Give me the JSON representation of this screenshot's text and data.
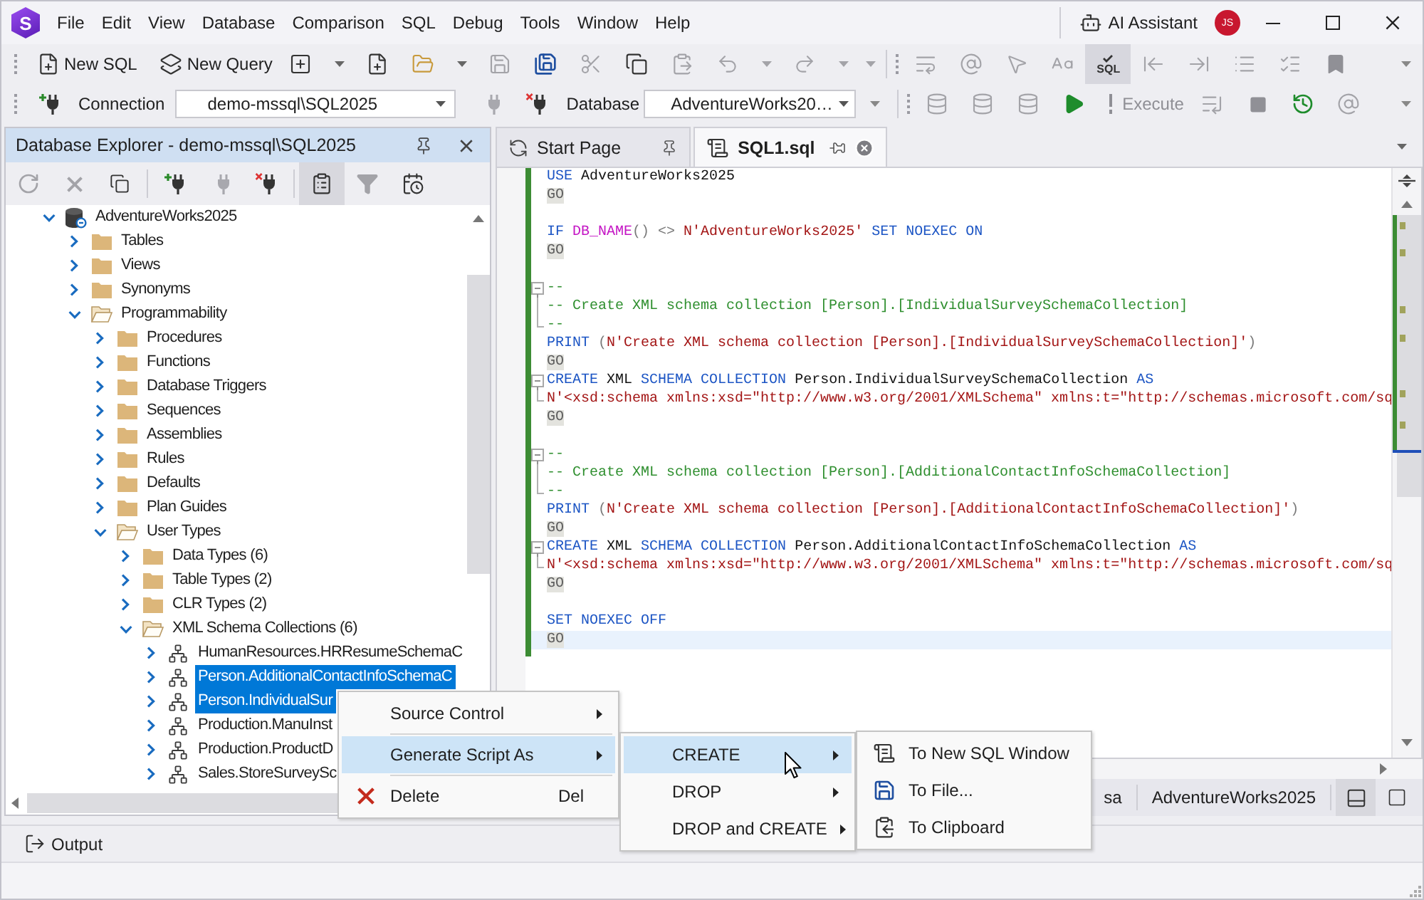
{
  "menu_bar": {
    "logo_letter": "S",
    "items": [
      "File",
      "Edit",
      "View",
      "Database",
      "Comparison",
      "SQL",
      "Debug",
      "Tools",
      "Window",
      "Help"
    ],
    "ai_assistant": "AI Assistant",
    "avatar_initials": "JS"
  },
  "main_toolbar": {
    "buttons": [
      "New SQL",
      "New Query"
    ],
    "sql_check": {
      "label": "SQL",
      "pressed": true
    }
  },
  "connection_toolbar": {
    "connection_label": "Connection",
    "connection": "demo-mssql\\SQL2025",
    "database_label": "Database",
    "database": "AdventureWorks20…",
    "execute": {
      "label": "Execute",
      "disabled": true
    }
  },
  "database_explorer": {
    "title": "Database Explorer - demo-mssql\\SQL2025",
    "tree": [
      {
        "label": "AdventureWorks2025",
        "kind": "database",
        "expanded": true,
        "selected": false,
        "children": [
          {
            "label": "Tables",
            "kind": "folder",
            "expanded": false,
            "selected": false
          },
          {
            "label": "Views",
            "kind": "folder",
            "expanded": false,
            "selected": false
          },
          {
            "label": "Synonyms",
            "kind": "folder",
            "expanded": false,
            "selected": false
          },
          {
            "label": "Programmability",
            "kind": "folder",
            "expanded": true,
            "selected": false,
            "children": [
              {
                "label": "Procedures",
                "kind": "folder",
                "expanded": false,
                "selected": false
              },
              {
                "label": "Functions",
                "kind": "folder",
                "expanded": false,
                "selected": false
              },
              {
                "label": "Database Triggers",
                "kind": "folder",
                "expanded": false,
                "selected": false
              },
              {
                "label": "Sequences",
                "kind": "folder",
                "expanded": false,
                "selected": false
              },
              {
                "label": "Assemblies",
                "kind": "folder",
                "expanded": false,
                "selected": false
              },
              {
                "label": "Rules",
                "kind": "folder",
                "expanded": false,
                "selected": false
              },
              {
                "label": "Defaults",
                "kind": "folder",
                "expanded": false,
                "selected": false
              },
              {
                "label": "Plan Guides",
                "kind": "folder",
                "expanded": false,
                "selected": false
              },
              {
                "label": "User Types",
                "kind": "folder",
                "expanded": true,
                "selected": false,
                "children": [
                  {
                    "label": "Data Types (6)",
                    "kind": "folder",
                    "expanded": false,
                    "selected": false
                  },
                  {
                    "label": "Table Types (2)",
                    "kind": "folder",
                    "expanded": false,
                    "selected": false
                  },
                  {
                    "label": "CLR Types (2)",
                    "kind": "folder",
                    "expanded": false,
                    "selected": false
                  },
                  {
                    "label": "XML Schema Collections (6)",
                    "kind": "folder",
                    "expanded": true,
                    "selected": false,
                    "children": [
                      {
                        "label": "HumanResources.HRResumeSchemaC",
                        "kind": "xml-schema",
                        "expanded": false,
                        "selected": false
                      },
                      {
                        "label": "Person.AdditionalContactInfoSchemaC",
                        "kind": "xml-schema",
                        "expanded": false,
                        "selected": true
                      },
                      {
                        "label": "Person.IndividualSur",
                        "kind": "xml-schema",
                        "expanded": false,
                        "selected": true
                      },
                      {
                        "label": "Production.ManuInst",
                        "kind": "xml-schema",
                        "expanded": false,
                        "selected": false
                      },
                      {
                        "label": "Production.ProductD",
                        "kind": "xml-schema",
                        "expanded": false,
                        "selected": false
                      },
                      {
                        "label": "Sales.StoreSurveySc",
                        "kind": "xml-schema",
                        "expanded": false,
                        "selected": false
                      }
                    ]
                  }
                ]
              }
            ]
          }
        ]
      }
    ]
  },
  "editor_tabs": [
    {
      "label": "Start Page",
      "selected": false,
      "pinned": true
    },
    {
      "label": "SQL1.sql",
      "selected": true,
      "pinned": false
    }
  ],
  "editor": {
    "lines": [
      {
        "kind": "code",
        "tokens": [
          {
            "kind": "keyword",
            "text": "USE"
          },
          {
            "kind": "plain",
            "text": " AdventureWorks2025"
          }
        ]
      },
      {
        "kind": "code",
        "tokens": [
          {
            "kind": "batch",
            "text": "GO"
          }
        ]
      },
      {
        "kind": "blank"
      },
      {
        "kind": "code",
        "tokens": [
          {
            "kind": "keyword",
            "text": "IF"
          },
          {
            "kind": "function",
            "text": " DB_NAME"
          },
          {
            "kind": "operator",
            "text": "() <> "
          },
          {
            "kind": "string",
            "text": "N'AdventureWorks2025'"
          },
          {
            "kind": "keyword",
            "text": " SET NOEXEC ON"
          }
        ]
      },
      {
        "kind": "code",
        "tokens": [
          {
            "kind": "batch",
            "text": "GO"
          }
        ]
      },
      {
        "kind": "blank"
      },
      {
        "kind": "code",
        "fold_start": true,
        "tokens": [
          {
            "kind": "comment",
            "text": "--"
          }
        ]
      },
      {
        "kind": "code",
        "fold_middle": true,
        "tokens": [
          {
            "kind": "comment",
            "text": "-- Create XML schema collection [Person].[IndividualSurveySchemaCollection]"
          }
        ]
      },
      {
        "kind": "code",
        "fold_end": true,
        "tokens": [
          {
            "kind": "comment",
            "text": "--"
          }
        ]
      },
      {
        "kind": "code",
        "tokens": [
          {
            "kind": "keyword",
            "text": "PRINT"
          },
          {
            "kind": "operator",
            "text": " ("
          },
          {
            "kind": "string",
            "text": "N'Create XML schema collection [Person].[IndividualSurveySchemaCollection]'"
          },
          {
            "kind": "operator",
            "text": ")"
          }
        ]
      },
      {
        "kind": "code",
        "tokens": [
          {
            "kind": "batch",
            "text": "GO"
          }
        ]
      },
      {
        "kind": "code",
        "fold_start": true,
        "tokens": [
          {
            "kind": "keyword",
            "text": "CREATE"
          },
          {
            "kind": "plain",
            "text": " XML "
          },
          {
            "kind": "keyword",
            "text": "SCHEMA COLLECTION"
          },
          {
            "kind": "plain",
            "text": " Person.IndividualSurveySchemaCollection "
          },
          {
            "kind": "keyword",
            "text": "AS"
          }
        ]
      },
      {
        "kind": "code",
        "fold_end": true,
        "tokens": [
          {
            "kind": "string",
            "text": "N'<xsd:schema xmlns:xsd=\"http://www.w3.org/2001/XMLSchema\" xmlns:t=\"http://schemas.microsoft.com/sq"
          }
        ]
      },
      {
        "kind": "code",
        "tokens": [
          {
            "kind": "batch",
            "text": "GO"
          }
        ]
      },
      {
        "kind": "blank"
      },
      {
        "kind": "code",
        "fold_start": true,
        "tokens": [
          {
            "kind": "comment",
            "text": "--"
          }
        ]
      },
      {
        "kind": "code",
        "fold_middle": true,
        "tokens": [
          {
            "kind": "comment",
            "text": "-- Create XML schema collection [Person].[AdditionalContactInfoSchemaCollection]"
          }
        ]
      },
      {
        "kind": "code",
        "fold_end": true,
        "tokens": [
          {
            "kind": "comment",
            "text": "--"
          }
        ]
      },
      {
        "kind": "code",
        "tokens": [
          {
            "kind": "keyword",
            "text": "PRINT"
          },
          {
            "kind": "operator",
            "text": " ("
          },
          {
            "kind": "string",
            "text": "N'Create XML schema collection [Person].[AdditionalContactInfoSchemaCollection]'"
          },
          {
            "kind": "operator",
            "text": ")"
          }
        ]
      },
      {
        "kind": "code",
        "tokens": [
          {
            "kind": "batch",
            "text": "GO"
          }
        ]
      },
      {
        "kind": "code",
        "fold_start": true,
        "tokens": [
          {
            "kind": "keyword",
            "text": "CREATE"
          },
          {
            "kind": "plain",
            "text": " XML "
          },
          {
            "kind": "keyword",
            "text": "SCHEMA COLLECTION"
          },
          {
            "kind": "plain",
            "text": " Person.AdditionalContactInfoSchemaCollection "
          },
          {
            "kind": "keyword",
            "text": "AS"
          }
        ]
      },
      {
        "kind": "code",
        "fold_end": true,
        "tokens": [
          {
            "kind": "string",
            "text": "N'<xsd:schema xmlns:xsd=\"http://www.w3.org/2001/XMLSchema\" xmlns:t=\"http://schemas.microsoft.com/sq"
          }
        ]
      },
      {
        "kind": "code",
        "tokens": [
          {
            "kind": "batch",
            "text": "GO"
          }
        ]
      },
      {
        "kind": "blank"
      },
      {
        "kind": "code",
        "tokens": [
          {
            "kind": "keyword",
            "text": "SET NOEXEC OFF"
          }
        ]
      },
      {
        "kind": "code",
        "current": true,
        "tokens": [
          {
            "kind": "batch",
            "text": "GO"
          }
        ]
      }
    ]
  },
  "status_bar": [
    "sa",
    "AdventureWorks2025"
  ],
  "output_tab": "Output",
  "context_menu": {
    "separators": true,
    "items": [
      {
        "label": "Source Control",
        "submenu": true,
        "selected": false
      },
      {
        "label": "Generate Script As",
        "submenu": true,
        "selected": true
      },
      {
        "label": "Delete",
        "shortcut": "Del",
        "submenu": false,
        "selected": false
      }
    ]
  },
  "script_submenu": {
    "items": [
      {
        "label": "CREATE",
        "submenu": true,
        "selected": true
      },
      {
        "label": "DROP",
        "submenu": true,
        "selected": false
      },
      {
        "label": "DROP and CREATE",
        "submenu": true,
        "selected": false
      }
    ]
  },
  "target_submenu": {
    "items": [
      {
        "label": "To New SQL Window",
        "selected": false
      },
      {
        "label": "To File...",
        "selected": false
      },
      {
        "label": "To Clipboard",
        "selected": false
      }
    ]
  }
}
